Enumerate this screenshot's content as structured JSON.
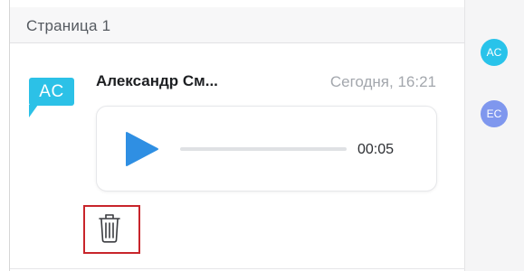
{
  "page": {
    "title": "Страница 1"
  },
  "message": {
    "avatar_initials": "AC",
    "author": "Александр См...",
    "timestamp": "Сегодня, 16:21",
    "audio": {
      "duration": "00:05",
      "progress": 0
    }
  },
  "participants": [
    {
      "initials": "AC"
    },
    {
      "initials": "EC"
    }
  ],
  "icons": {
    "play": "play-icon",
    "trash": "trash-icon"
  },
  "colors": {
    "accent": "#2cc1e7",
    "play": "#2f8fe3",
    "delete_highlight": "#c8252b",
    "participant_ec": "#7f97ee"
  }
}
